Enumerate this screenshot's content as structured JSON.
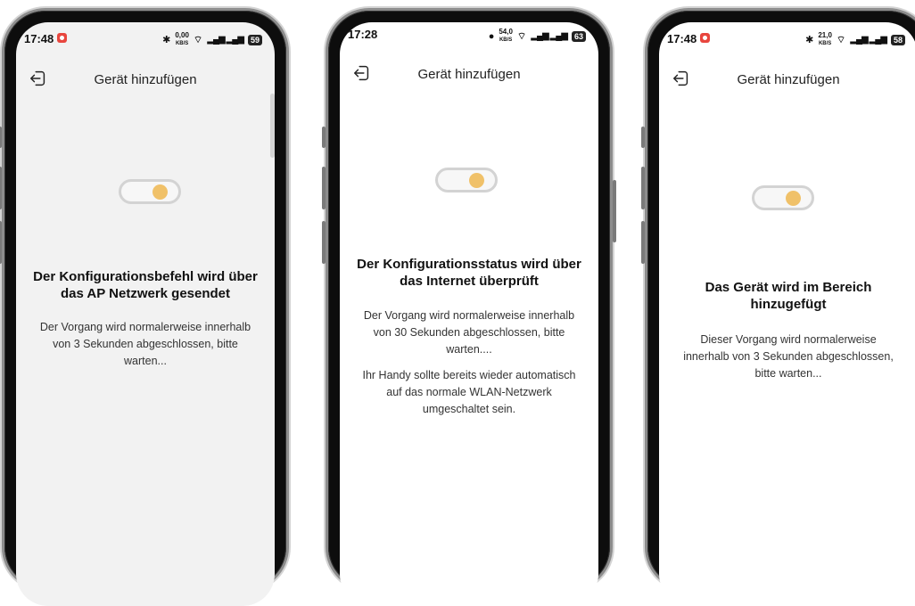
{
  "screens": [
    {
      "time": "17:48",
      "network_speed": "0,00",
      "speed_unit": "KB/S",
      "signal_label": "⁵ᴳ",
      "battery": "59",
      "title": "Gerät hinzufügen",
      "heading": "Der Konfigurationsbefehl wird über das AP Netzwerk gesendet",
      "description": "Der Vorgang wird normalerweise innerhalb von 3 Sekunden abgeschlossen, bitte warten...",
      "note": "",
      "background": "#f2f2f2",
      "toggle_state": "on"
    },
    {
      "time": "17:28",
      "network_speed": "54,0",
      "speed_unit": "KB/S",
      "signal_label": "⁵ᴳ",
      "battery": "63",
      "title": "Gerät hinzufügen",
      "heading": "Der Konfigurationsstatus wird über das Internet überprüft",
      "description": "Der Vorgang wird normalerweise innerhalb von 30 Sekunden abgeschlossen, bitte warten....",
      "note": "Ihr Handy sollte bereits wieder automatisch auf das normale WLAN-Netzwerk umgeschaltet sein.",
      "background": "#ffffff",
      "toggle_state": "on"
    },
    {
      "time": "17:48",
      "network_speed": "21,0",
      "speed_unit": "KB/S",
      "signal_label": "⁵ᴳ",
      "battery": "58",
      "title": "Gerät hinzufügen",
      "heading": "Das Gerät wird im Bereich hinzugefügt",
      "description": "Dieser Vorgang wird normalerweise innerhalb von 3 Sekunden abgeschlossen, bitte warten...",
      "note": "",
      "background": "#ffffff",
      "toggle_state": "on"
    }
  ],
  "colors": {
    "toggle_knob": "#f0c169",
    "toggle_track_border": "#d3d3d3",
    "recording_badge": "#e8463e"
  },
  "icons": {
    "back": "exit-arrow-icon",
    "bluetooth": "bluetooth-icon",
    "wifi": "wifi-icon",
    "location": "location-icon"
  }
}
